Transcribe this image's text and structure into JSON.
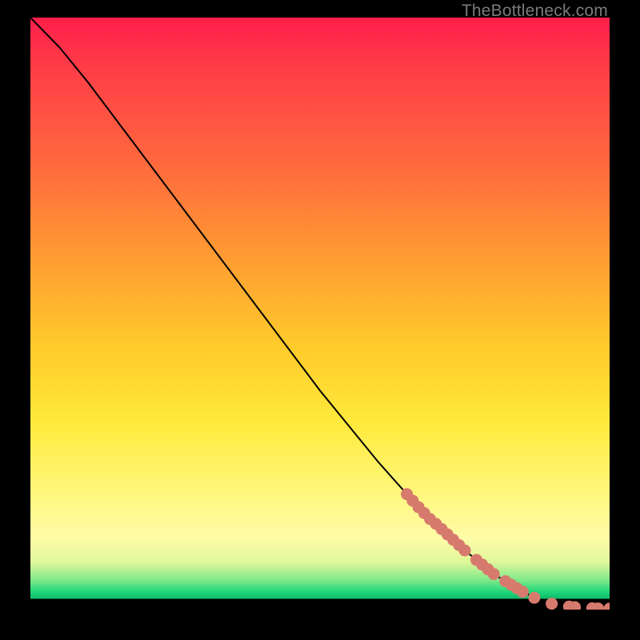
{
  "watermark": "TheBottleneck.com",
  "colors": {
    "curve_stroke": "#000000",
    "marker_fill": "#d77a6e",
    "marker_stroke": "#c86a60"
  },
  "chart_data": {
    "type": "line",
    "title": "",
    "xlabel": "",
    "ylabel": "",
    "xlim": [
      0,
      100
    ],
    "ylim": [
      0,
      100
    ],
    "grid": false,
    "legend": false,
    "series": [
      {
        "name": "curve",
        "x": [
          0,
          5,
          10,
          15,
          20,
          25,
          30,
          35,
          40,
          45,
          50,
          55,
          60,
          65,
          70,
          75,
          80,
          85,
          88,
          90,
          92,
          94,
          96,
          98,
          100
        ],
        "y": [
          100,
          95,
          89,
          82.5,
          76,
          69.5,
          63,
          56.5,
          50,
          43.5,
          37,
          31,
          25,
          19.5,
          14.5,
          10,
          6,
          3,
          1.6,
          1,
          0.6,
          0.4,
          0.25,
          0.18,
          0.15
        ]
      }
    ],
    "markers": [
      {
        "x": 65,
        "y": 19.5
      },
      {
        "x": 66,
        "y": 18.4
      },
      {
        "x": 67,
        "y": 17.3
      },
      {
        "x": 68,
        "y": 16.3
      },
      {
        "x": 69,
        "y": 15.3
      },
      {
        "x": 70,
        "y": 14.5
      },
      {
        "x": 71,
        "y": 13.6
      },
      {
        "x": 72,
        "y": 12.7
      },
      {
        "x": 73,
        "y": 11.8
      },
      {
        "x": 74,
        "y": 10.9
      },
      {
        "x": 75,
        "y": 10.0
      },
      {
        "x": 77,
        "y": 8.4
      },
      {
        "x": 78,
        "y": 7.6
      },
      {
        "x": 79,
        "y": 6.8
      },
      {
        "x": 80,
        "y": 6.0
      },
      {
        "x": 82,
        "y": 4.8
      },
      {
        "x": 83,
        "y": 4.2
      },
      {
        "x": 84,
        "y": 3.6
      },
      {
        "x": 85,
        "y": 3.0
      },
      {
        "x": 87,
        "y": 2.0
      },
      {
        "x": 90,
        "y": 1.0
      },
      {
        "x": 93,
        "y": 0.5
      },
      {
        "x": 94,
        "y": 0.4
      },
      {
        "x": 97,
        "y": 0.22
      },
      {
        "x": 98,
        "y": 0.18
      },
      {
        "x": 100,
        "y": 0.15
      }
    ]
  }
}
